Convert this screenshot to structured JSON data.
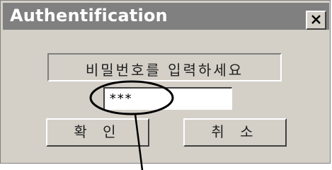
{
  "window": {
    "title": "Authentification",
    "close_icon": "close-icon"
  },
  "prompt": {
    "text": "비밀번호를 입력하세요"
  },
  "password": {
    "value": "***"
  },
  "buttons": {
    "ok_label": "확 인",
    "cancel_label": "취 소"
  },
  "colors": {
    "titlebar": "#808080",
    "face": "#d4d0c8",
    "callout": "#000000"
  }
}
